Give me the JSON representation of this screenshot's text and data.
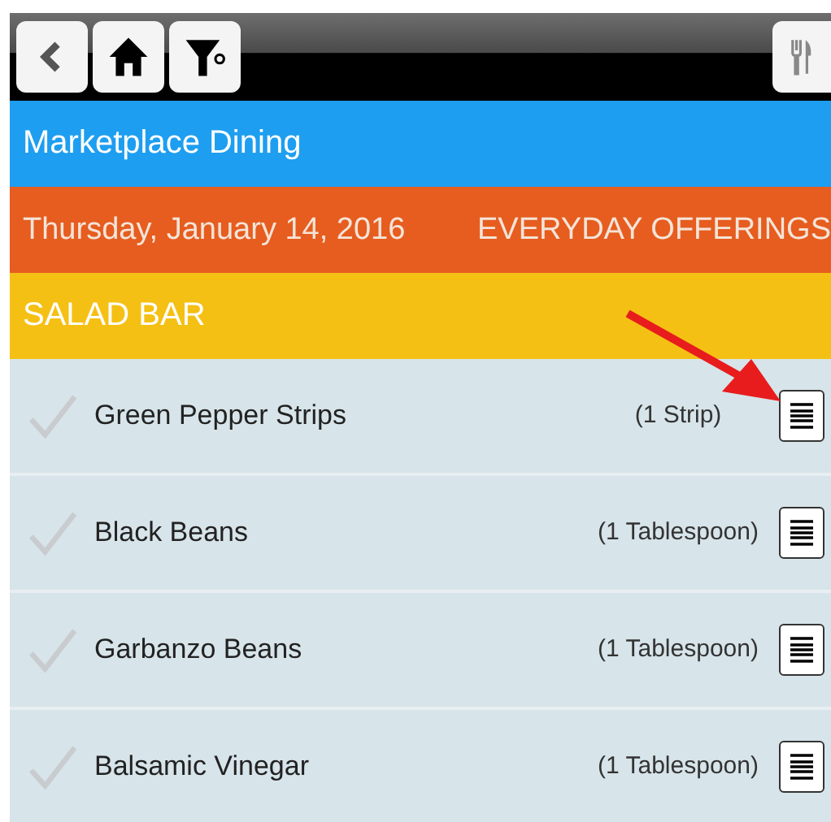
{
  "toolbar": {
    "buttons": [
      {
        "kind": "back"
      },
      {
        "kind": "home"
      },
      {
        "kind": "filter"
      }
    ],
    "right_button": {
      "kind": "menu"
    }
  },
  "location": "Marketplace Dining",
  "date_bar": {
    "date": "Thursday, January 14, 2016",
    "meal": "EVERYDAY OFFERINGS"
  },
  "station": "SALAD BAR",
  "items": [
    {
      "name": "Green Pepper Strips",
      "portion": "(1 Strip)",
      "checked": false
    },
    {
      "name": "Black Beans",
      "portion": "(1 Tablespoon)",
      "checked": false
    },
    {
      "name": "Garbanzo Beans",
      "portion": "(1 Tablespoon)",
      "checked": false
    },
    {
      "name": "Balsamic Vinegar",
      "portion": "(1 Tablespoon)",
      "checked": false
    }
  ]
}
